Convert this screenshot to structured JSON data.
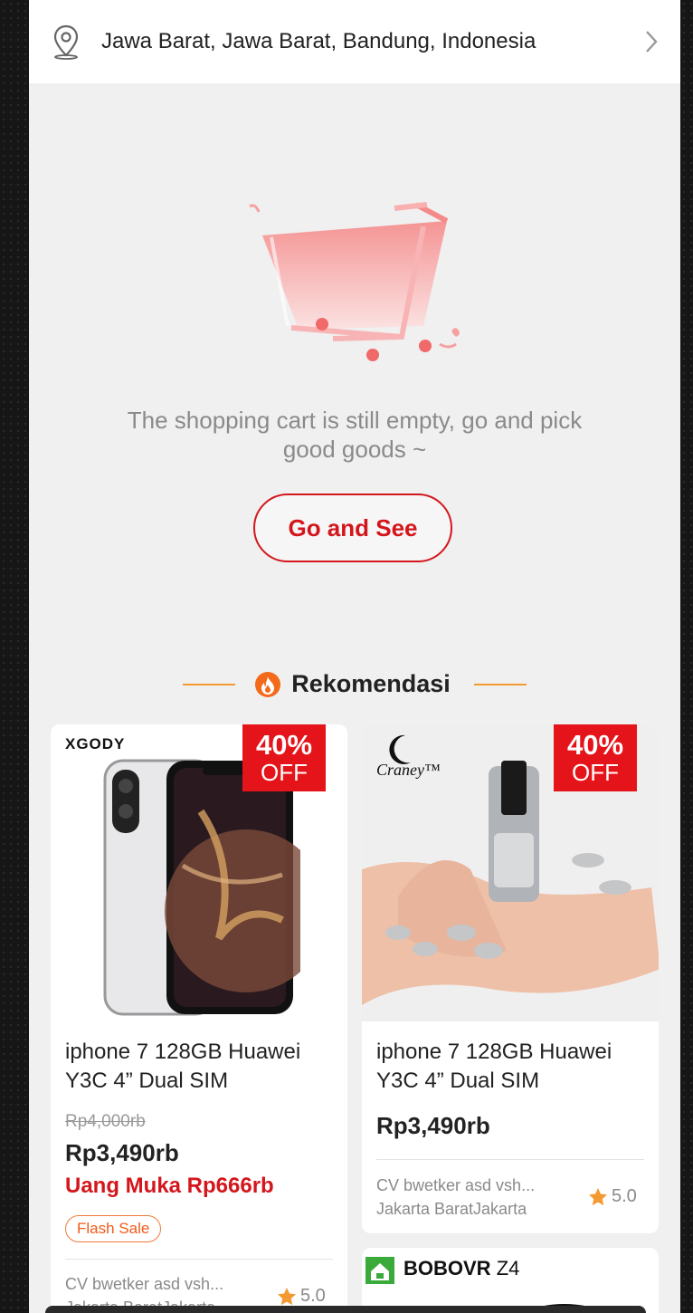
{
  "address": "Jawa Barat, Jawa Barat, Bandung, Indonesia",
  "empty_cart": {
    "message": "The shopping cart is still empty, go and pick good goods ~",
    "button_label": "Go and See"
  },
  "recommend": {
    "title": "Rekomendasi"
  },
  "products": [
    {
      "brand": "XGODY",
      "badge_pct": "40%",
      "badge_off": "OFF",
      "name": "iphone 7 128GB Huawei Y3C 4” Dual SIM",
      "old_price": "Rp4,000rb",
      "price": "Rp3,490rb",
      "down_payment": "Uang Muka Rp666rb",
      "tag": "Flash Sale",
      "seller": "CV bwetker asd vsh...",
      "location": "Jakarta BaratJakarta",
      "rating": "5.0"
    },
    {
      "brand": "Craney™",
      "badge_pct": "40%",
      "badge_off": "OFF",
      "name": "iphone 7 128GB Huawei Y3C 4” Dual SIM",
      "price": "Rp3,490rb",
      "seller": "CV bwetker asd vsh...",
      "location": "Jakarta BaratJakarta",
      "rating": "5.0"
    },
    {
      "brand_bold": "BOBOVR",
      "brand_model": "Z4"
    }
  ],
  "colors": {
    "accent": "#d4161c",
    "badge": "#e5141a",
    "flash_tag": "#f05a1a",
    "star": "#f39a32"
  }
}
